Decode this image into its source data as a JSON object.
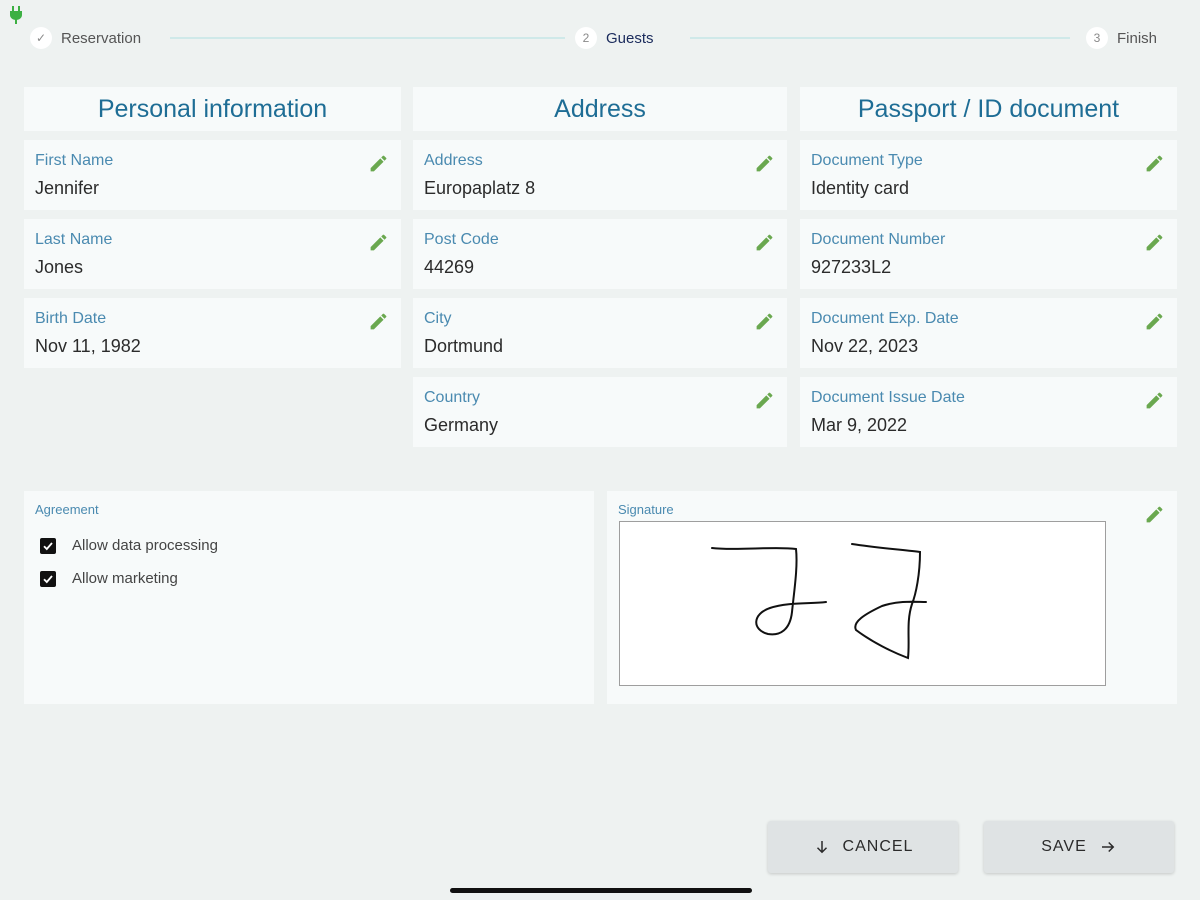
{
  "colors": {
    "accent_blue": "#1e6d95",
    "label_blue": "#4a8ab0",
    "edit_green": "#6aa84f",
    "plug_green": "#3cb043",
    "background": "#eef2f1"
  },
  "status": {
    "icon": "plug-icon"
  },
  "stepper": {
    "steps": [
      {
        "number": "✓",
        "label": "Reservation",
        "state": "done"
      },
      {
        "number": "2",
        "label": "Guests",
        "state": "active"
      },
      {
        "number": "3",
        "label": "Finish",
        "state": "pending"
      }
    ]
  },
  "personal": {
    "title": "Personal information",
    "fields": [
      {
        "label": "First Name",
        "value": "Jennifer"
      },
      {
        "label": "Last Name",
        "value": "Jones"
      },
      {
        "label": "Birth Date",
        "value": "Nov 11, 1982"
      }
    ]
  },
  "address": {
    "title": "Address",
    "fields": [
      {
        "label": "Address",
        "value": "Europaplatz 8"
      },
      {
        "label": "Post Code",
        "value": "44269"
      },
      {
        "label": "City",
        "value": "Dortmund"
      },
      {
        "label": "Country",
        "value": "Germany"
      }
    ]
  },
  "passport": {
    "title": "Passport / ID document",
    "fields": [
      {
        "label": "Document Type",
        "value": "Identity card"
      },
      {
        "label": "Document Number",
        "value": "927233L2"
      },
      {
        "label": "Document Exp. Date",
        "value": "Nov 22, 2023"
      },
      {
        "label": "Document Issue Date",
        "value": "Mar 9, 2022"
      }
    ]
  },
  "agreement": {
    "label": "Agreement",
    "items": [
      {
        "label": "Allow data processing",
        "checked": true
      },
      {
        "label": "Allow marketing",
        "checked": true
      }
    ]
  },
  "signature": {
    "label": "Signature"
  },
  "actions": {
    "cancel_label": "CANCEL",
    "save_label": "SAVE"
  }
}
